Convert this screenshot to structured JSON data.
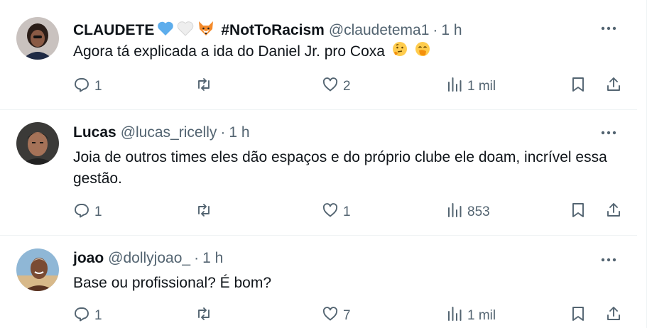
{
  "tweets": [
    {
      "name": "CLAUDETE",
      "hashtag": "#NotToRacism",
      "handle": "@claudetema1",
      "separator": "·",
      "time": "1 h",
      "text": "Agora tá explicada a ida do Daniel Jr. pro Coxa",
      "name_emojis": [
        "blue-heart-icon",
        "white-heart-icon",
        "fox-icon"
      ],
      "text_emojis": [
        "thinking-face-icon",
        "hand-over-mouth-icon"
      ],
      "replies": "1",
      "retweets": "",
      "likes": "2",
      "views": "1 mil"
    },
    {
      "name": "Lucas",
      "handle": "@lucas_ricelly",
      "separator": "·",
      "time": "1 h",
      "text": "Joia de outros times eles dão espaços e do próprio clube ele doam, incrível essa gestão.",
      "replies": "1",
      "retweets": "",
      "likes": "1",
      "views": "853"
    },
    {
      "name": "joao",
      "handle": "@dollyjoao_",
      "separator": "·",
      "time": "1 h",
      "text": "Base ou profissional? É bom?",
      "replies": "1",
      "retweets": "",
      "likes": "7",
      "views": "1 mil"
    }
  ],
  "colors": {
    "text": "#0f1419",
    "secondary": "#536471",
    "divider": "#eff3f4",
    "heart_blue": "#5dadec"
  }
}
